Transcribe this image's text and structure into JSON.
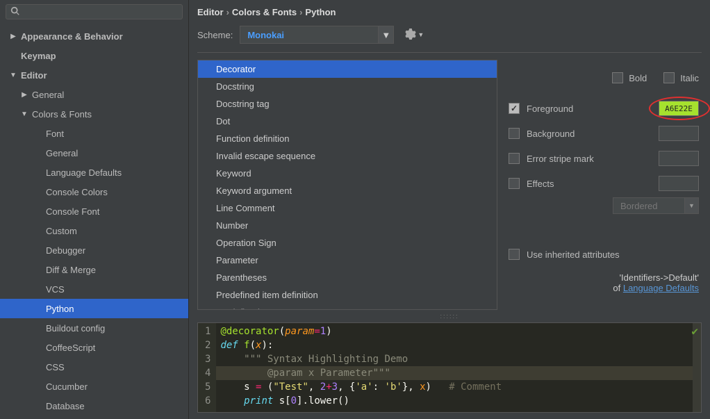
{
  "search": {
    "placeholder": ""
  },
  "tree": [
    {
      "label": "Appearance & Behavior",
      "indent": 0,
      "arrow": "right",
      "bold": true
    },
    {
      "label": "Keymap",
      "indent": 0,
      "arrow": "",
      "bold": true
    },
    {
      "label": "Editor",
      "indent": 0,
      "arrow": "down",
      "bold": true
    },
    {
      "label": "General",
      "indent": 1,
      "arrow": "right"
    },
    {
      "label": "Colors & Fonts",
      "indent": 1,
      "arrow": "down"
    },
    {
      "label": "Font",
      "indent": 2,
      "arrow": ""
    },
    {
      "label": "General",
      "indent": 2,
      "arrow": ""
    },
    {
      "label": "Language Defaults",
      "indent": 2,
      "arrow": ""
    },
    {
      "label": "Console Colors",
      "indent": 2,
      "arrow": ""
    },
    {
      "label": "Console Font",
      "indent": 2,
      "arrow": ""
    },
    {
      "label": "Custom",
      "indent": 2,
      "arrow": ""
    },
    {
      "label": "Debugger",
      "indent": 2,
      "arrow": ""
    },
    {
      "label": "Diff & Merge",
      "indent": 2,
      "arrow": ""
    },
    {
      "label": "VCS",
      "indent": 2,
      "arrow": ""
    },
    {
      "label": "Python",
      "indent": 2,
      "arrow": "",
      "selected": true
    },
    {
      "label": "Buildout config",
      "indent": 2,
      "arrow": ""
    },
    {
      "label": "CoffeeScript",
      "indent": 2,
      "arrow": ""
    },
    {
      "label": "CSS",
      "indent": 2,
      "arrow": ""
    },
    {
      "label": "Cucumber",
      "indent": 2,
      "arrow": ""
    },
    {
      "label": "Database",
      "indent": 2,
      "arrow": ""
    }
  ],
  "breadcrumb": [
    "Editor",
    "Colors & Fonts",
    "Python"
  ],
  "scheme": {
    "label": "Scheme:",
    "value": "Monokai"
  },
  "attributes": [
    "Decorator",
    "Docstring",
    "Docstring tag",
    "Dot",
    "Function definition",
    "Invalid escape sequence",
    "Keyword",
    "Keyword argument",
    "Line Comment",
    "Number",
    "Operation Sign",
    "Parameter",
    "Parentheses",
    "Predefined item definition",
    "Predefined name"
  ],
  "attr_selected": 0,
  "style": {
    "bold": "Bold",
    "italic": "Italic",
    "foreground": "Foreground",
    "foreground_val": "A6E22E",
    "background": "Background",
    "error_stripe": "Error stripe mark",
    "effects": "Effects",
    "effects_type": "Bordered",
    "inherited": "Use inherited attributes",
    "inherit_from_1": "'Identifiers->Default'",
    "inherit_from_2": "of ",
    "inherit_link": "Language Defaults"
  },
  "preview": {
    "lines": [
      "1",
      "2",
      "3",
      "4",
      "5",
      "6"
    ]
  }
}
